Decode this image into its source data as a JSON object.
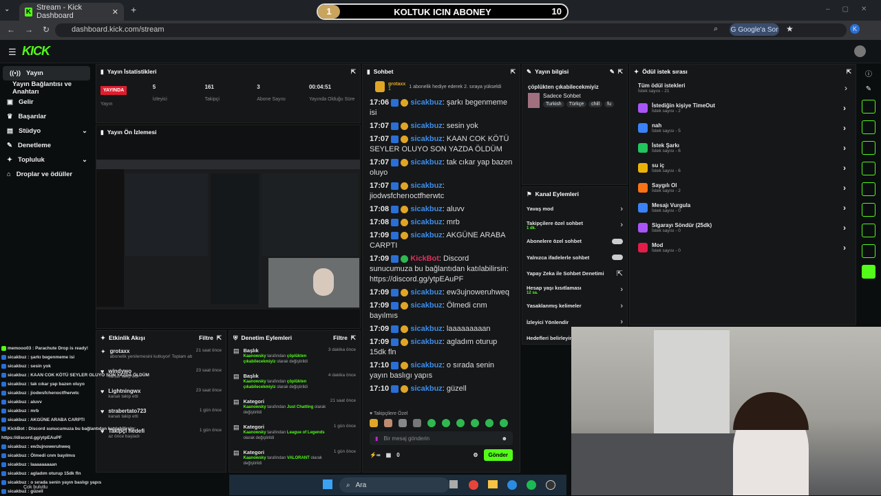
{
  "browser": {
    "tab_title": "Stream - Kick Dashboard",
    "url": "dashboard.kick.com/stream",
    "google_btn": "Google'a Sor",
    "avatar_letter": "K"
  },
  "goal": {
    "left": "1",
    "title": "KOLTUK ICIN ABONEY",
    "right": "10"
  },
  "logo": "KICK",
  "sidebar": [
    "Yayın",
    "Yayın Bağlantısı ve Anahtarı",
    "Gelir",
    "Başarılar",
    "Stüdyo",
    "Denetleme",
    "Topluluk",
    "Droplar ve ödüller"
  ],
  "stats": {
    "title": "Yayın İstatistikleri",
    "status": "YAYINDA",
    "status_label": "Yayın",
    "viewers": "5",
    "viewers_label": "İzleyici",
    "followers": "161",
    "followers_label": "Takipçi",
    "subs": "3",
    "subs_label": "Abone Sayısı",
    "time": "00:04:51",
    "time_label": "Yayında Olduğu Süre"
  },
  "preview": {
    "title": "Yayın Ön İzlemesi"
  },
  "activity": {
    "title": "Etkinlik Akışı",
    "filter": "Filtre",
    "items": [
      {
        "user": "grotaxx",
        "desc": "abonelik yenilemesini kutluyor! Toplam abonelik süresi - 2 ay!",
        "time": "21 saat önce"
      },
      {
        "user": "windywo",
        "desc": "kanalı takip etti",
        "time": "23 saat önce"
      },
      {
        "user": "Lightningwx",
        "desc": "kanalı takip etti",
        "time": "23 saat önce"
      },
      {
        "user": "strabertato723",
        "desc": "kanalı takip etti",
        "time": "1 gün önce"
      },
      {
        "user": "Takipçi hedefi",
        "desc": "az önce başladı",
        "time": "1 gün önce"
      }
    ]
  },
  "moderation": {
    "title": "Denetim Eylemleri",
    "filter": "Filtre",
    "items": [
      {
        "title": "Başlık",
        "mod": "Kaanowsky",
        "mid": "tarafından",
        "val": "çöplükten çıkabilecekmiyiz",
        "end": "olarak değiştirildi",
        "time": "3 dakika önce"
      },
      {
        "title": "Başlık",
        "mod": "Kaanowsky",
        "mid": "tarafından",
        "val": "çöplükten çıkabilecekmiyiz",
        "end": "olarak değiştirildi",
        "time": "4 dakika önce"
      },
      {
        "title": "Kategori",
        "mod": "Kaanowsky",
        "mid": "tarafından",
        "val": "Just Chatting",
        "end": "olarak değiştirildi",
        "time": "21 saat önce"
      },
      {
        "title": "Kategori",
        "mod": "Kaanowsky",
        "mid": "tarafından",
        "val": "League of Legends",
        "end": "olarak değiştirildi",
        "time": "1 gün önce"
      },
      {
        "title": "Kategori",
        "mod": "Kaanowsky",
        "mid": "tarafından",
        "val": "VALORANT",
        "end": "olarak değiştirildi",
        "time": "1 gün önce"
      }
    ]
  },
  "chat": {
    "title": "Sohbet",
    "pinned_user": "grotaxx",
    "pinned_count": "1",
    "pinned_text": "1 abonelik hediye ederek 2. sıraya yükseldi",
    "messages": [
      {
        "t": "17:06",
        "u": "sicakbuz",
        "m": "şarkı begenmeme isi"
      },
      {
        "t": "17:07",
        "u": "sicakbuz",
        "m": "sesin yok"
      },
      {
        "t": "17:07",
        "u": "sicakbuz",
        "m": "KAAN COK KÖTÜ SEYLER OLUYO SON YAZDA ÖLDÜM"
      },
      {
        "t": "17:07",
        "u": "sicakbuz",
        "m": "tak cıkar yap bazen oluyo"
      },
      {
        "t": "17:07",
        "u": "sicakbuz",
        "m": "jiodwsfcherıoctfherwtc"
      },
      {
        "t": "17:08",
        "u": "sicakbuz",
        "m": "aluvv"
      },
      {
        "t": "17:08",
        "u": "sicakbuz",
        "m": "mrb"
      },
      {
        "t": "17:09",
        "u": "sicakbuz",
        "m": "AKGÜNE ARABA CARPTI"
      },
      {
        "t": "17:09",
        "u": "KickBot",
        "m": "Discord sunucumuza bu bağlantıdan katılabilirsin: https://discord.gg/ytpEAuPF"
      },
      {
        "t": "17:09",
        "u": "sicakbuz",
        "m": "ew3ujnoweruhweq"
      },
      {
        "t": "17:09",
        "u": "sicakbuz",
        "m": "Ölmedi cnm bayılmıs"
      },
      {
        "t": "17:09",
        "u": "sicakbuz",
        "m": "laaaaaaaaan"
      },
      {
        "t": "17:09",
        "u": "sicakbuz",
        "m": "agladım oturup 15dk fln"
      },
      {
        "t": "17:10",
        "u": "sicakbuz",
        "m": "o sırada senin yayın baslıgı yapıs"
      },
      {
        "t": "17:10",
        "u": "sicakbuz",
        "m": "güzell"
      }
    ],
    "followers_only": "Takipçilere Özel",
    "placeholder": "Bir mesaj gönderin",
    "count": "0",
    "send": "Gönder"
  },
  "info": {
    "title": "Yayın bilgisi",
    "stream_title": "çöplükten çıkabilecekmiyiz",
    "category": "Sadece Sohbet",
    "tags": [
      "Turkish",
      "Türkçe",
      "chill",
      "fu"
    ]
  },
  "channel": {
    "title": "Kanal Eylemleri",
    "items": [
      {
        "label": "Yavaş mod",
        "sub": ""
      },
      {
        "label": "Takipçilere özel sohbet",
        "sub": "1 dk."
      },
      {
        "label": "Abonelere özel sohbet",
        "sub": ""
      },
      {
        "label": "Yalnızca ifadelerle sohbet",
        "sub": ""
      },
      {
        "label": "Yapay Zeka ile Sohbet Denetimi",
        "sub": ""
      },
      {
        "label": "Hesap yaşı kısıtlaması",
        "sub": "12 sa."
      },
      {
        "label": "Yasaklanmış kelimeler",
        "sub": ""
      },
      {
        "label": "İzleyici Yönlendir",
        "sub": ""
      },
      {
        "label": "Hedefleri belirleyin",
        "sub": ""
      }
    ]
  },
  "rewards": {
    "title": "Ödül istek sırası",
    "all": "Tüm ödül istekleri",
    "all_count": "İstek sayısı - 21",
    "items": [
      {
        "name": "İstediğin kişiye TimeOut",
        "count": "İstek sayısı - 2",
        "color": "#a855f7"
      },
      {
        "name": "nah",
        "count": "İstek sayısı - 5",
        "color": "#3b82f6"
      },
      {
        "name": "İstek Şarkı",
        "count": "İstek sayısı - 6",
        "color": "#22c55e"
      },
      {
        "name": "su iç",
        "count": "İstek sayısı - 6",
        "color": "#eab308"
      },
      {
        "name": "Saygılı Ol",
        "count": "İstek sayısı - 2",
        "color": "#f97316"
      },
      {
        "name": "Mesajı Vurgula",
        "count": "İstek sayısı - 0",
        "color": "#3b82f6"
      },
      {
        "name": "Sigarayı Söndür (25dk)",
        "count": "İstek sayısı - 0",
        "color": "#a855f7"
      },
      {
        "name": "Mod",
        "count": "İstek sayısı - 0",
        "color": "#e11d48"
      }
    ]
  },
  "overlay": {
    "lines": [
      "memooo03 : Parachute Drop is ready!",
      "sicakbuz : şarkı begenmeme isi",
      "sicakbuz : sesin yok",
      "sicakbuz : KAAN COK KÖTÜ SEYLER OLUYO SON YAZDA ÖLDÜM",
      "sicakbuz : tak cıkar yap bazen oluyo",
      "sicakbuz : jiodwsfcherıoctfherwtc",
      "sicakbuz : aluvv",
      "sicakbuz : mrb",
      "sicakbuz : AKGÜNE ARABA CARPTI",
      "KickBot : Discord sunucumuza bu bağlantıdan katılabilirsin:",
      "https://discord.gg/ytpEAuPF",
      "sicakbuz : ew3ujnoweruhweq",
      "sicakbuz : Ölmedi cnm bayılmıs",
      "sicakbuz : laaaaaaaaan",
      "sicakbuz : agladım oturup 15dk fln",
      "sicakbuz : o sırada senin yayın baslıgı yapıs",
      "sicakbuz : güzell"
    ],
    "weather": "Çok bulutlu"
  },
  "taskbar": {
    "search": "Ara"
  }
}
